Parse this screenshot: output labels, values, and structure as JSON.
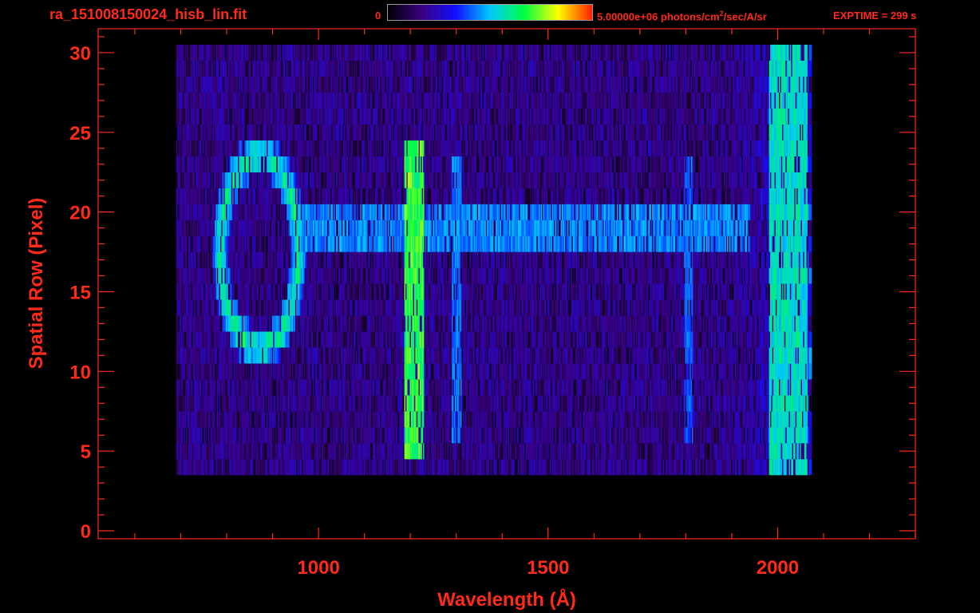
{
  "header": {
    "filename": "ra_151008150024_hisb_lin.fit",
    "colorbar_min": "0",
    "colorbar_max_prefix": "5.00000e+06 photons/cm",
    "colorbar_max_exp": "2",
    "colorbar_max_suffix": "/sec/A/sr",
    "exptime": "EXPTIME = 299 s"
  },
  "colors": {
    "axis": "#ff2a1a",
    "background": "#000000",
    "colormap": [
      "#000000",
      "#3b0080",
      "#1010ff",
      "#00c8ff",
      "#00ff40",
      "#ffff00",
      "#ff2000"
    ]
  },
  "chart_data": {
    "type": "heatmap",
    "title": "ra_151008150024_hisb_lin.fit",
    "xlabel": "Wavelength (Å)",
    "ylabel": "Spatial Row (Pixel)",
    "xlim": [
      520,
      2300
    ],
    "ylim": [
      -0.5,
      31.5
    ],
    "x_ticks": [
      1000,
      1500,
      2000
    ],
    "y_ticks": [
      0,
      5,
      10,
      15,
      20,
      25,
      30
    ],
    "x_minor_step": 100,
    "y_minor_step": 1,
    "colorbar": {
      "min": 0,
      "max": 5000000,
      "units": "photons/cm^2/sec/A/sr"
    },
    "data_extent": {
      "x": [
        690,
        2070
      ],
      "rows": [
        4,
        30
      ]
    },
    "features": [
      {
        "name": "ring",
        "type": "ellipse",
        "center_x": 870,
        "center_row": 17.5,
        "half_width_x": 85,
        "half_height_rows": 6,
        "intensity": 0.62
      },
      {
        "name": "line_1216",
        "type": "vertical_band",
        "x_from": 1185,
        "x_to": 1230,
        "rows": [
          5,
          24
        ],
        "intensity": 0.68
      },
      {
        "name": "line_1304",
        "type": "vertical_band",
        "x_from": 1290,
        "x_to": 1310,
        "rows": [
          6,
          23
        ],
        "intensity": 0.42
      },
      {
        "name": "line_1800",
        "type": "vertical_band",
        "x_from": 1795,
        "x_to": 1815,
        "rows": [
          6,
          23
        ],
        "intensity": 0.4
      },
      {
        "name": "continuum_stripe",
        "type": "horizontal_band",
        "x_from": 960,
        "x_to": 1940,
        "rows": [
          18,
          20
        ],
        "intensity": 0.44
      },
      {
        "name": "red_edge",
        "type": "vertical_band",
        "x_from": 1980,
        "x_to": 2065,
        "rows": [
          1,
          30
        ],
        "intensity": 0.55
      }
    ]
  }
}
